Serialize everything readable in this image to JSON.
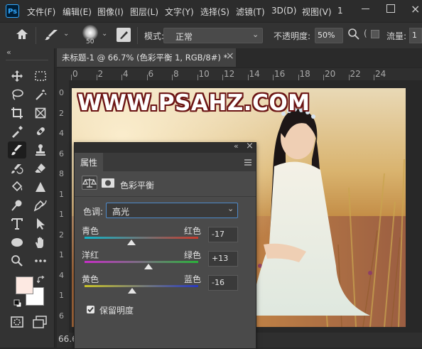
{
  "app": {
    "logo": "Ps"
  },
  "menu": [
    "文件(F)",
    "编辑(E)",
    "图像(I)",
    "图层(L)",
    "文字(Y)",
    "选择(S)",
    "滤镜(T)",
    "3D(D)",
    "视图(V)",
    "1"
  ],
  "options_bar": {
    "brush_size": "50",
    "mode_label": "模式:",
    "mode_value": "正常",
    "opacity_label": "不透明度:",
    "opacity_value": "50%",
    "flow_label": "流量:",
    "flow_value": "1"
  },
  "toolbar": {
    "collapse": "«"
  },
  "document": {
    "tab_title": "未标题-1 @ 66.7% (色彩平衡 1, RGB/8#) *",
    "tab_close": "×",
    "zoom_status": "66.6"
  },
  "rulers": {
    "horizontal": [
      "0",
      "2",
      "4",
      "6",
      "8",
      "10",
      "12",
      "14",
      "16",
      "18",
      "20",
      "22",
      "24"
    ],
    "vertical": [
      "0",
      "2",
      "4",
      "6",
      "8",
      "1",
      "1",
      "2",
      "1",
      "4",
      "1",
      "6"
    ]
  },
  "watermark": "WWW.PSAHZ.COM",
  "properties_panel": {
    "title": "属性",
    "header_collapse": "«",
    "header_close": "×",
    "adjustment_name": "色彩平衡",
    "tone_label": "色调:",
    "tone_value": "高光",
    "sliders": [
      {
        "left": "青色",
        "right": "红色",
        "value": "-17",
        "colors": [
          "#10b4c8",
          "#c83a2c"
        ]
      },
      {
        "left": "洋红",
        "right": "绿色",
        "value": "+13",
        "colors": [
          "#c62ec6",
          "#2ab23a"
        ]
      },
      {
        "left": "黄色",
        "right": "蓝色",
        "value": "-16",
        "colors": [
          "#c8c228",
          "#2838c0"
        ]
      }
    ],
    "preserve_luminosity": "保留明度",
    "preserve_checked": true
  },
  "colors": {
    "foreground": "#fde9e2",
    "background": "#ffffff",
    "accent": "#31a8ff"
  }
}
